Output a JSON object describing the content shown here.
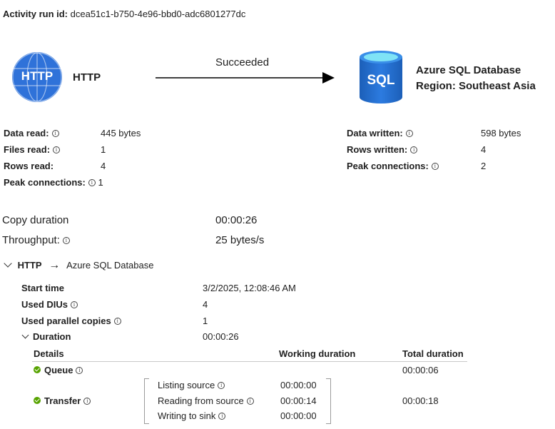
{
  "run": {
    "label": "Activity run id:",
    "id": "dcea51c1-b750-4e96-bbd0-adc6801277dc"
  },
  "source": {
    "icon_text": "HTTP",
    "name": "HTTP"
  },
  "arrow": {
    "status": "Succeeded"
  },
  "sink": {
    "icon_text": "SQL",
    "name": "Azure SQL Database",
    "region": "Region: Southeast Asia"
  },
  "source_stats": {
    "data_read_label": "Data read:",
    "data_read": "445 bytes",
    "files_read_label": "Files read:",
    "files_read": "1",
    "rows_read_label": "Rows read:",
    "rows_read": "4",
    "peak_label": "Peak connections:",
    "peak": "1"
  },
  "sink_stats": {
    "data_written_label": "Data written:",
    "data_written": "598 bytes",
    "rows_written_label": "Rows written:",
    "rows_written": "4",
    "peak_label": "Peak connections:",
    "peak": "2"
  },
  "summary": {
    "copy_duration_label": "Copy duration",
    "copy_duration": "00:00:26",
    "throughput_label": "Throughput:",
    "throughput": "25 bytes/s"
  },
  "pipeline": {
    "source": "HTTP",
    "arrow": "→",
    "sink": "Azure SQL Database"
  },
  "details": {
    "start_time_label": "Start time",
    "start_time": "3/2/2025, 12:08:46 AM",
    "dius_label": "Used DIUs",
    "dius": "4",
    "copies_label": "Used parallel copies",
    "copies": "1",
    "duration_label": "Duration",
    "duration": "00:00:26"
  },
  "table": {
    "col_details": "Details",
    "col_working": "Working duration",
    "col_total": "Total duration",
    "queue": {
      "label": "Queue",
      "total": "00:00:06"
    },
    "transfer": {
      "label": "Transfer",
      "total": "00:00:18",
      "steps": [
        {
          "label": "Listing source",
          "value": "00:00:00"
        },
        {
          "label": "Reading from source",
          "value": "00:00:14"
        },
        {
          "label": "Writing to sink",
          "value": "00:00:00"
        }
      ]
    }
  }
}
